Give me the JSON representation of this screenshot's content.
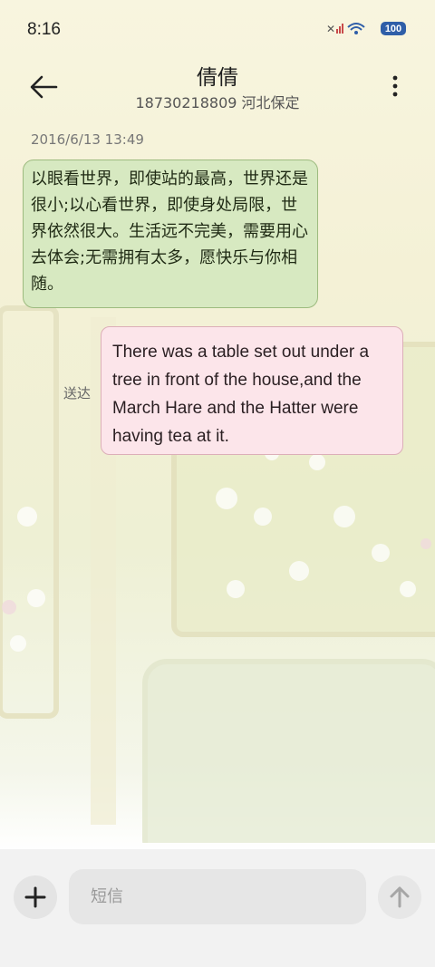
{
  "status_bar": {
    "time": "8:16",
    "battery": "100",
    "wifi_icon": "wifi-icon",
    "signal_icon": "signal-icon"
  },
  "header": {
    "contact_name": "倩倩",
    "contact_subtitle": "18730218809 河北保定"
  },
  "messages": [
    {
      "timestamp": "2016/6/13 13:49",
      "direction": "incoming",
      "text": "以眼看世界，即使站的最高，世界还是很小;以心看世界，即使身处局限，世界依然很大。生活远不完美，需要用心去体会;无需拥有太多，愿快乐与你相随。"
    },
    {
      "direction": "outgoing",
      "status": "送达",
      "text": "There was a table set out under a tree in front of the house,and the March Hare and the Hatter were having tea at it."
    }
  ],
  "composer": {
    "placeholder": "短信"
  },
  "colors": {
    "incoming_bubble": "#d7e9c1",
    "outgoing_bubble": "#fce5ea",
    "background": "#f8f5df"
  }
}
